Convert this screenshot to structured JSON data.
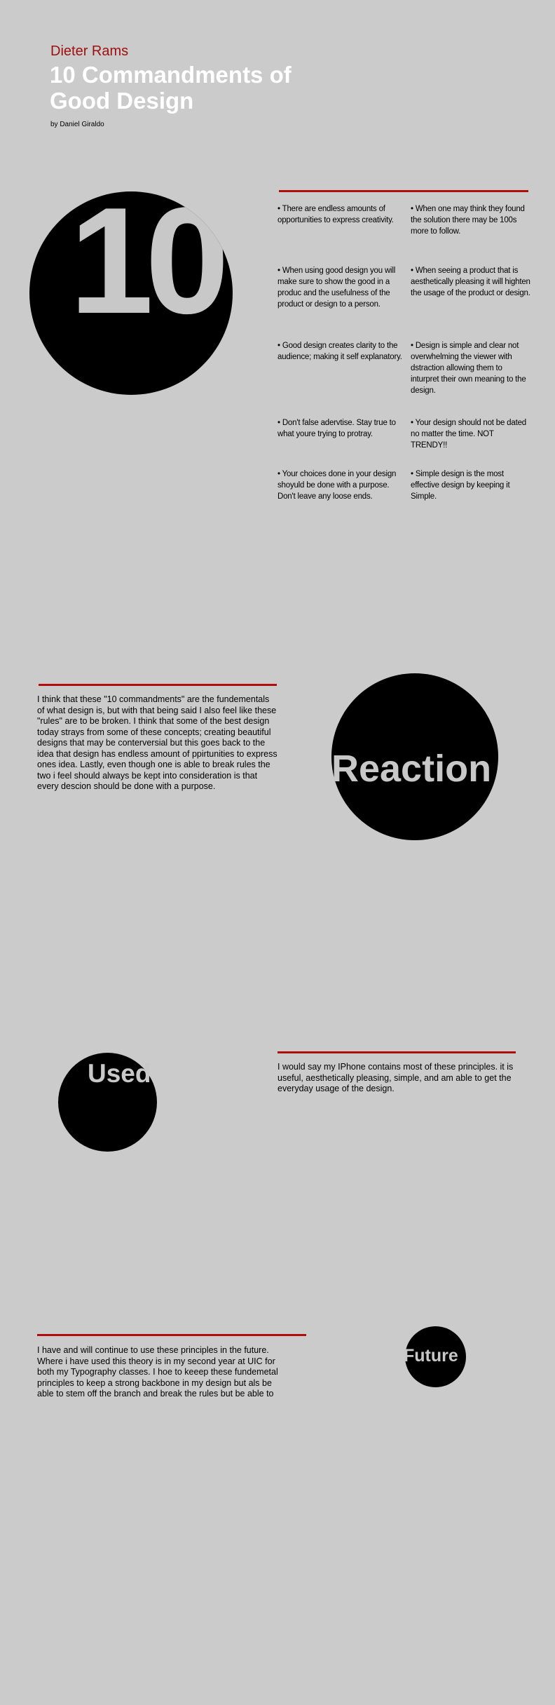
{
  "header": {
    "author": "Dieter Rams",
    "title": "10 Commandments of Good Design",
    "byline": "by Daniel Giraldo"
  },
  "commandments": {
    "badge": "10",
    "items": [
      "• There are endless amounts of opportunities to express creativity.",
      "• When one may think they found the solution there may be 100s more to follow.",
      "• When using good design you will make sure to show the good in a produc and the usefulness of the product or design to a person.",
      "• When seeing a product that is aesthetically pleasing it will highten the usage of the product or design.",
      "• Good design creates clarity to the audience; making it self explanatory.",
      "• Design is simple and clear not overwhelming the viewer with dstraction allowing them to inturpret their own meaning to the design.",
      "• Don't false adervtise. Stay true to what youre trying to protray.",
      "•  Your design should not be dated no matter the time. NOT TRENDY!!",
      "• Your choices done in your design shoyuld be done with a purpose. Don't leave any loose ends.",
      "• Simple design is the most effective design by keeping it Simple."
    ]
  },
  "reaction": {
    "badge": "Reaction",
    "text": "I think that these \"10 commandments\" are the fundementals of what design is, but with that being said I also feel like these \"rules\" are to be broken. I think that some of the best design today strays from some of these concepts; creating beautiful designs that may be conterversial but this goes back to the idea that design has endless amount of ppirtunities to express ones idea. Lastly, even though one is able to break rules the two i feel should always be kept into consideration is that every descion should be done with a purpose."
  },
  "used": {
    "badge": "Used",
    "text": "I would say my IPhone contains most of these principles. it is useful, aesthetically pleasing, simple, and am able to get the everyday usage of the design."
  },
  "future": {
    "badge": "Future",
    "text": "I have and will continue to use these principles in the future. Where i have used this theory is in my second year at UIC for both my Typography classes. I hoe to keeep these fundemetal principles to keep a strong backbone in my design but als be able to stem off the branch and break the rules but be able to"
  },
  "colors": {
    "background": "#cbcbcb",
    "accent": "#b00d0d",
    "circle": "#000000",
    "title": "#ffffff"
  }
}
